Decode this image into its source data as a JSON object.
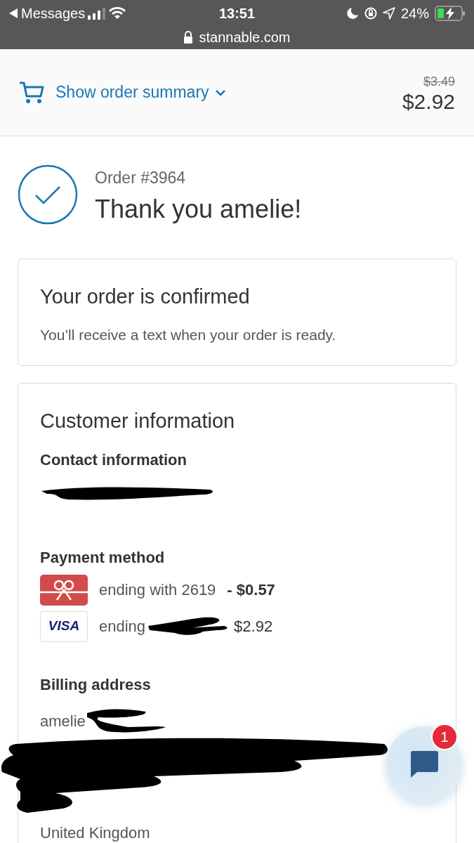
{
  "status_bar": {
    "back_app": "Messages",
    "time": "13:51",
    "battery": "24%",
    "url": "stannable.com"
  },
  "summary_bar": {
    "link": "Show order summary",
    "original_price": "$3.49",
    "total": "$2.92"
  },
  "order": {
    "number": "Order #3964",
    "heading": "Thank you amelie!"
  },
  "confirmation": {
    "title": "Your order is confirmed",
    "text": "You’ll receive a text when your order is ready."
  },
  "customer": {
    "title": "Customer information",
    "contact_label": "Contact information",
    "payment_label": "Payment method",
    "payments": [
      {
        "kind": "gift_card",
        "text": "ending with 2619",
        "amount": "- $0.57"
      },
      {
        "kind": "visa",
        "logo": "VISA",
        "text": "ending",
        "amount": "$2.92"
      }
    ],
    "billing_label": "Billing address",
    "billing_lines": [
      "amelie",
      "United Kingdom"
    ]
  },
  "chat": {
    "badge": "1"
  }
}
